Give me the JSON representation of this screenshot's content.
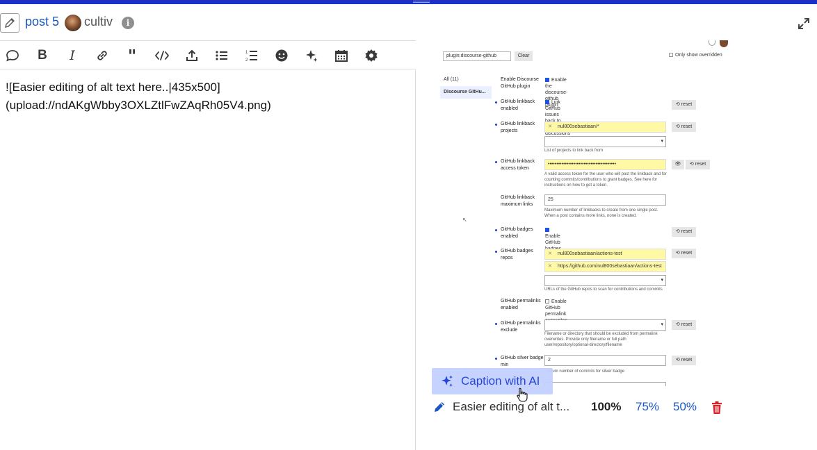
{
  "header": {
    "post_title": "post 5",
    "username": "cultiv",
    "info_glyph": "i"
  },
  "toolbar": {
    "buttons": [
      {
        "name": "quote-icon",
        "glyph": "◯"
      },
      {
        "name": "bold-icon",
        "glyph": "B"
      },
      {
        "name": "italic-icon",
        "glyph": "I"
      },
      {
        "name": "link-icon",
        "glyph": "⚭"
      },
      {
        "name": "blockquote-icon",
        "glyph": "❞"
      },
      {
        "name": "code-icon",
        "glyph": "</>"
      },
      {
        "name": "upload-icon",
        "glyph": "⭱"
      },
      {
        "name": "bullet-list-icon",
        "glyph": "☰"
      },
      {
        "name": "numbered-list-icon",
        "glyph": "☷"
      },
      {
        "name": "emoji-icon",
        "glyph": "☻"
      },
      {
        "name": "ai-sparkle-icon",
        "glyph": "✦"
      },
      {
        "name": "calendar-icon",
        "glyph": "▦"
      },
      {
        "name": "settings-gear-icon",
        "glyph": "⚙"
      }
    ]
  },
  "editor": {
    "content": "![Easier editing of alt text here..|435x500]\n(upload://ndAKgWbby3OXLZtlFwZAqRh05V4.png)"
  },
  "preview": {
    "screenshot": {
      "filter_value": "plugin:discourse-github",
      "clear_label": "Clear",
      "only_overridden_label": "Only show overridden",
      "sidebar_all": "All (11)",
      "sidebar_current": "Discourse GitHu...",
      "reset_label": "⟲ reset",
      "settings": {
        "enable_label": "Enable Discourse GitHub plugin",
        "enable_check": "Enable the discourse-github plugin",
        "linkback_enabled_label": "GitHub linkback enabled",
        "linkback_enabled_check": "Link GitHub issues back to forum discussions",
        "linkback_projects_label": "GitHub linkback projects",
        "linkback_projects_value": "nul800sebastiaan/*",
        "linkback_projects_hint": "List of projects to link back from",
        "access_token_label": "GitHub linkback access token",
        "access_token_value": "••••••••••••••••••••••••••••••••••••••••",
        "access_token_hint": "A valid access token for the user who will post the linkback and for counting commits/contributions to grant badges. See here for instructions on how to get a token.",
        "max_links_label": "GitHub linkback maximum links",
        "max_links_value": "25",
        "max_links_hint": "Maximum number of linkbacks to create from one single post. When a post contains more links, none is created.",
        "badges_enabled_label": "GitHub badges enabled",
        "badges_enabled_check": "Enable GitHub badges",
        "badges_repos_label": "GitHub badges repos",
        "badges_repos_value1": "nul800sebastiaan/actions-test",
        "badges_repos_value2": "https://github.com/nul800sebastiaan/actions-test",
        "badges_repos_hint": "URLs of the GitHub repos to scan for contributions and commits",
        "permalinks_label": "GitHub permalinks enabled",
        "permalinks_check": "Enable GitHub permalink overwrites",
        "permalinks_exclude_label": "GitHub permalinks exclude",
        "permalinks_exclude_hint": "Filename or directory that should be excluded from permalink overwrites. Provide only filename or full path user/repository/optional-directory/filename",
        "silver_label": "GitHub silver badge min",
        "silver_value": "2",
        "silver_hint": "...imum number of commits for silver badge"
      }
    },
    "caption_button_label": "Caption with AI",
    "alt_text": "Easier editing of alt t...",
    "zoom_options": [
      "100%",
      "75%",
      "50%"
    ]
  },
  "colors": {
    "accent": "#1c3dd6",
    "link": "#1a56c4",
    "danger": "#d6242b",
    "topbar": "#1c2fc7",
    "highlight": "#fff9a6"
  }
}
